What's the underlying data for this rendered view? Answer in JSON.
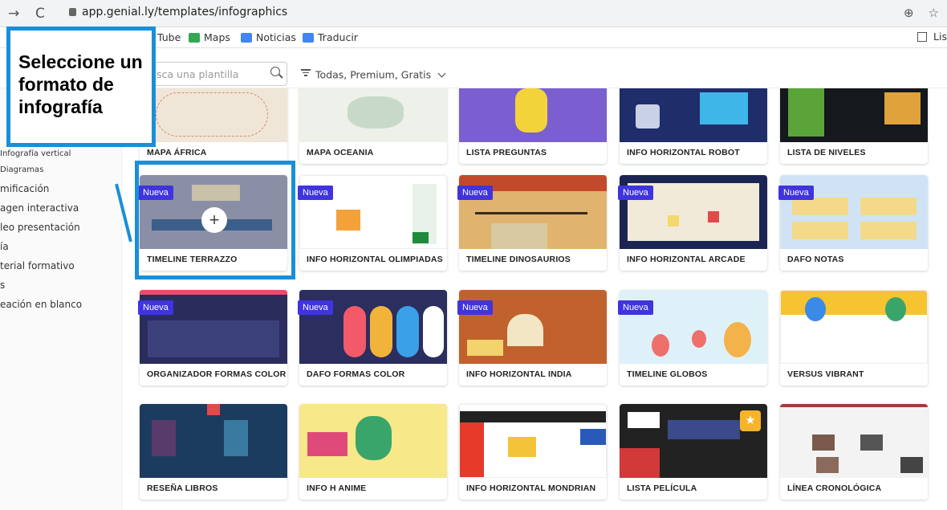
{
  "browser": {
    "url": "app.genial.ly/templates/infographics"
  },
  "bookmarks": [
    {
      "label": "Tube",
      "color": "#ffffff"
    },
    {
      "label": "Maps",
      "color": "#34a853"
    },
    {
      "label": "Noticias",
      "color": "#4285f4"
    },
    {
      "label": "Traducir",
      "color": "#4285f4"
    }
  ],
  "bookmarks_right": "Lis",
  "search": {
    "placeholder": "sca una plantilla"
  },
  "filter": {
    "label": "Todas, Premium, Gratis"
  },
  "sidebar": [
    {
      "label": "Infografía vertical"
    },
    {
      "label": "Diagramas"
    },
    {
      "label": "mificación"
    },
    {
      "label": "agen interactiva"
    },
    {
      "label": "leo presentación"
    },
    {
      "label": "ía"
    },
    {
      "label": "terial formativo"
    },
    {
      "label": "s"
    },
    {
      "label": "eación en blanco"
    }
  ],
  "callout": {
    "text": "Seleccione un formato de infografía"
  },
  "new_badge": "Nueva",
  "templates": [
    {
      "name": "MAPA ÁFRICA",
      "thumb": "#efe6d8",
      "accent": "#d58a6a",
      "badge": false
    },
    {
      "name": "MAPA OCEANIA",
      "thumb": "#eef1ea",
      "accent": "#c7d9c8",
      "badge": false
    },
    {
      "name": "LISTA PREGUNTAS",
      "thumb": "#7b5fd0",
      "accent": "#f2d43a",
      "badge": false
    },
    {
      "name": "INFO HORIZONTAL ROBOT",
      "thumb": "#1f2d6b",
      "accent": "#3fb6e8",
      "badge": false
    },
    {
      "name": "LISTA DE NIVELES",
      "thumb": "#15181c",
      "accent": "#5aa43a",
      "badge": false
    },
    {
      "name": "TIMELINE TERRAZZO",
      "thumb": "#8a8fa6",
      "accent": "#3b5f8a",
      "badge": true
    },
    {
      "name": "INFO HORIZONTAL OLIMPIADAS",
      "thumb": "#ffffff",
      "accent": "#1f8a3a",
      "badge": true
    },
    {
      "name": "TIMELINE DINOSAURIOS",
      "thumb": "#e0b46e",
      "accent": "#c24a2a",
      "badge": true
    },
    {
      "name": "INFO HORIZONTAL ARCADE",
      "thumb": "#1b2554",
      "accent": "#f3d86c",
      "badge": true
    },
    {
      "name": "DAFO NOTAS",
      "thumb": "#cfe3f5",
      "accent": "#f5d98a",
      "badge": true
    },
    {
      "name": "ORGANIZADOR FORMAS COLOR",
      "thumb": "#2a2d5c",
      "accent": "#e84c6b",
      "badge": true
    },
    {
      "name": "DAFO FORMAS COLOR",
      "thumb": "#2b2e5e",
      "accent": "#f25a6a",
      "badge": true
    },
    {
      "name": "INFO HORIZONTAL INDIA",
      "thumb": "#c1622e",
      "accent": "#f3d36b",
      "badge": true
    },
    {
      "name": "TIMELINE GLOBOS",
      "thumb": "#dff1f8",
      "accent": "#ef6f6a",
      "badge": true
    },
    {
      "name": "VERSUS VIBRANT",
      "thumb": "#ffffff",
      "accent": "#f6c430",
      "badge": false
    },
    {
      "name": "RESEÑA LIBROS",
      "thumb": "#1c3c5f",
      "accent": "#e8c24a",
      "badge": false
    },
    {
      "name": "INFO H ANIME",
      "thumb": "#f7e88a",
      "accent": "#e04a7a",
      "badge": false
    },
    {
      "name": "INFO HORIZONTAL MONDRIAN",
      "thumb": "#ffffff",
      "accent": "#e63a2a",
      "badge": false
    },
    {
      "name": "LISTA PELÍCULA",
      "thumb": "#222222",
      "accent": "#d23a3a",
      "badge": false
    },
    {
      "name": "LÍNEA CRONOLÓGICA",
      "thumb": "#f3f3f3",
      "accent": "#a43a3a",
      "badge": false
    }
  ]
}
